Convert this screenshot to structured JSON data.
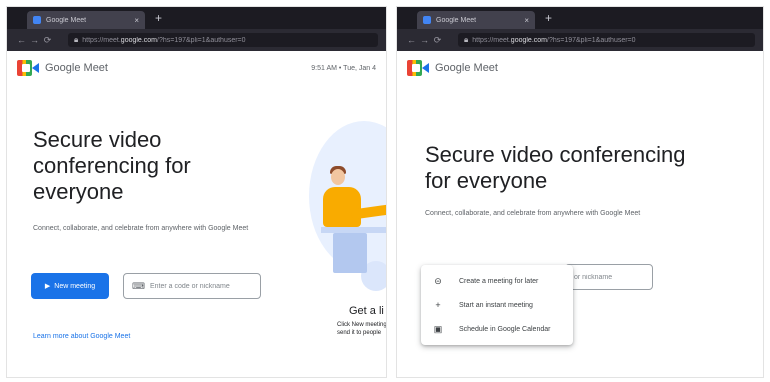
{
  "left": {
    "tab": {
      "title": "Google Meet",
      "close": "×",
      "new_tab": "+"
    },
    "toolbar": {
      "back": "←",
      "forward": "→",
      "reload": "⟳",
      "url_prefix": "https://meet.",
      "url_host": "google.com",
      "url_rest": "/?hs=197&pli=1&authuser=0"
    },
    "header": {
      "brand": "Google Meet",
      "right_text": "9:51 AM • Tue, Jan 4"
    },
    "hero": {
      "title": "Secure video conferencing for everyone",
      "subtitle": "Connect, collaborate, and celebrate from anywhere with Google Meet"
    },
    "new_meeting": "New meeting",
    "code_placeholder": "Enter a code or nickname",
    "learn_more": "Learn more about Google Meet",
    "illustration": {
      "caption": "Get a li",
      "sub1": "Click New meeting",
      "sub2": "send it to people"
    }
  },
  "right": {
    "tab": {
      "title": "Google Meet",
      "close": "×",
      "new_tab": "+"
    },
    "toolbar": {
      "back": "←",
      "forward": "→",
      "reload": "⟳",
      "url_prefix": "https://meet.",
      "url_host": "google.com",
      "url_rest": "/?hs=197&pli=1&authuser=0"
    },
    "header": {
      "brand": "Google Meet"
    },
    "hero": {
      "title": "Secure video conferencing for everyone",
      "subtitle": "Connect, collaborate, and celebrate from anywhere with Google Meet"
    },
    "code_placeholder": "or nickname",
    "menu": [
      {
        "icon": "link-icon",
        "glyph": "⊝",
        "label": "Create a meeting for later"
      },
      {
        "icon": "plus-icon",
        "glyph": "+",
        "label": "Start an instant meeting"
      },
      {
        "icon": "calendar-icon",
        "glyph": "▣",
        "label": "Schedule in Google Calendar"
      }
    ]
  },
  "colors": {
    "accent": "#1a73e8",
    "chrome_dark": "#1c1b22",
    "toolbar": "#2b2a33",
    "illustration_yellow": "#f9ab00"
  }
}
